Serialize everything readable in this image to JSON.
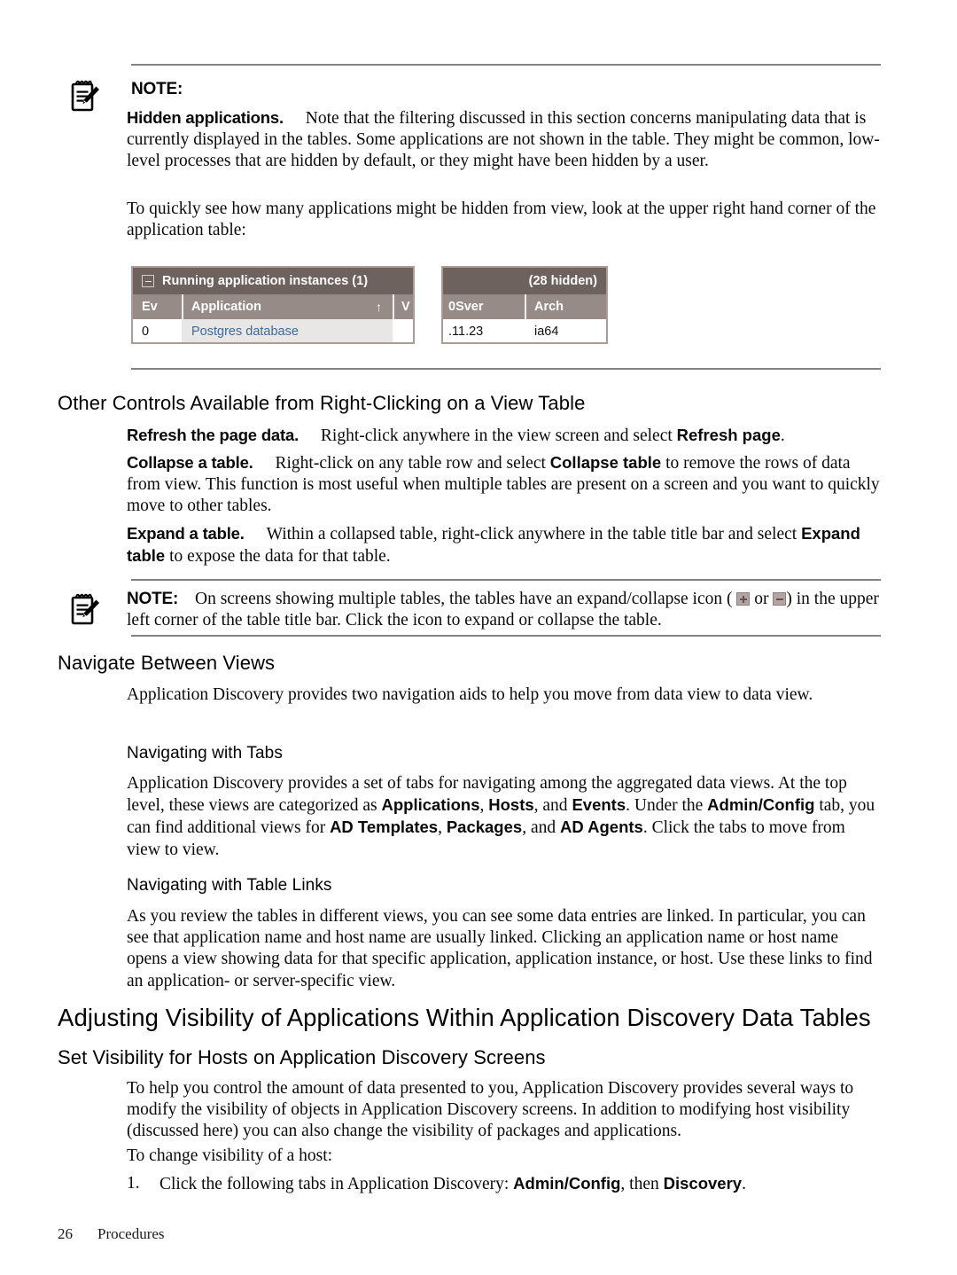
{
  "note1": {
    "label": "NOTE:",
    "icon": "note-pencil-icon",
    "lead_in": "Hidden applications.",
    "paragraph1": "Note that the filtering discussed in this section concerns manipulating data that is currently displayed in the tables. Some applications are not shown in the table. They might be common, low-level processes that are hidden by default, or they might have been hidden by a user.",
    "paragraph2": "To quickly see how many applications might be hidden from view, look at the upper right hand corner of the application table:"
  },
  "screenshot": {
    "title": "Running application instances (1)",
    "hidden_count": "(28 hidden)",
    "collapse_icon": "collapse-minus-icon",
    "sort_indicator": "↑",
    "columns_left": [
      "Ev",
      "Application",
      "V"
    ],
    "columns_right": [
      "0Sver",
      "Arch"
    ],
    "row_left": [
      "0",
      "Postgres database"
    ],
    "row_right": [
      ".11.23",
      "ia64"
    ],
    "colors": {
      "titlebar": "#6e625f",
      "column_header": "#978b87",
      "border": "#b09a98",
      "link": "#3d6a9e"
    }
  },
  "section_other_controls": {
    "heading": "Other Controls Available from Right-Clicking on a View Table",
    "items": [
      {
        "lead_in": "Refresh the page data.",
        "text_before": "Right-click anywhere in the view screen and select ",
        "bold_inline": "Refresh page",
        "text_after": "."
      },
      {
        "lead_in": "Collapse a table.",
        "text_before": "Right-click on any table row and select ",
        "bold_inline": "Collapse table",
        "text_after": " to remove the rows of data from view. This function is most useful when multiple tables are present on a screen and you want to quickly move to other tables."
      },
      {
        "lead_in": "Expand a table.",
        "text_before": "Within a collapsed table, right-click anywhere in the table title bar and select ",
        "bold_inline": "Expand table",
        "text_after": " to expose the data for that table."
      }
    ]
  },
  "note2": {
    "label": "NOTE:",
    "icon": "note-pencil-icon",
    "text_part1": "On screens showing multiple tables, the tables have an expand/collapse icon ( ",
    "icon_expand": "expand-plus-icon",
    "text_or": " or ",
    "icon_collapse": "collapse-minus-icon",
    "text_part2": ") in the upper left corner of the table title bar. Click the icon to expand or collapse the table."
  },
  "section_navigate": {
    "heading": "Navigate Between Views",
    "intro": "Application Discovery provides two navigation aids to help you move from data view to data view.",
    "sub1": {
      "heading": "Navigating with Tabs",
      "text_1": "Application Discovery provides a set of tabs for navigating among the aggregated data views. At the top level, these views are categorized as ",
      "b1": "Applications",
      "text_2": ", ",
      "b2": "Hosts",
      "text_3": ", and ",
      "b3": "Events",
      "text_4": ". Under the ",
      "b4": "Admin/Config",
      "text_5": " tab, you can find additional views for ",
      "b5": "AD Templates",
      "text_6": ", ",
      "b6": "Packages",
      "text_7": ", and ",
      "b7": "AD Agents",
      "text_8": ". Click the tabs to move from view to view."
    },
    "sub2": {
      "heading": "Navigating with Table Links",
      "text": "As you review the tables in different views, you can see some data entries are linked. In particular, you can see that application name and host name are usually linked. Clicking an application name or host name opens a view showing data for that specific application, application instance, or host. Use these links to find an application- or server-specific view."
    }
  },
  "section_adjusting": {
    "heading": "Adjusting Visibility of Applications Within Application Discovery Data Tables",
    "subheading": "Set Visibility for Hosts on Application Discovery Screens",
    "paragraph1": "To help you control the amount of data presented to you, Application Discovery provides several ways to modify the visibility of objects in Application Discovery screens. In addition to modifying host visibility (discussed here) you can also change the visibility of packages and applications.",
    "paragraph2": "To change visibility of a host:",
    "list": [
      {
        "number": "1.",
        "text_before": "Click the following tabs in Application Discovery: ",
        "b1": "Admin/Config",
        "text_middle": ", then ",
        "b2": "Discovery",
        "text_after": "."
      }
    ]
  },
  "footer": {
    "page_number": "26",
    "section_name": "Procedures"
  }
}
